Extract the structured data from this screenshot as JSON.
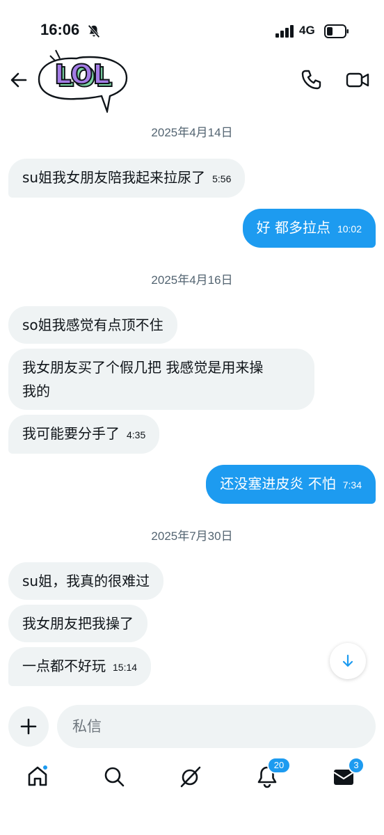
{
  "status": {
    "time": "16:06",
    "network": "4G",
    "icons": [
      "bell-muted-icon",
      "signal-icon",
      "battery-icon"
    ]
  },
  "header": {
    "avatar_text": "LOL",
    "icons": [
      "back-arrow-icon",
      "phone-icon",
      "video-icon"
    ]
  },
  "messages": {
    "date1": "2025年4月14日",
    "m1": "su姐我女朋友陪我起来拉尿了",
    "m1_time": "5:56",
    "m2": "好 都多拉点",
    "m2_time": "10:02",
    "date2": "2025年4月16日",
    "m3": "so姐我感觉有点顶不住",
    "m4_line1": "我女朋友买了个假几把 我感觉是用来操",
    "m4_line2": "我的",
    "m5": "我可能要分手了",
    "m5_time": "4:35",
    "m6": "还没塞进皮炎 不怕",
    "m6_time": "7:34",
    "date3": "2025年7月30日",
    "m7": "su姐，我真的很难过",
    "m8": "我女朋友把我操了",
    "m9": "一点都不好玩",
    "m9_time": "15:14"
  },
  "composer": {
    "placeholder": "私信"
  },
  "nav": {
    "notifications_badge": "20",
    "messages_badge": "3"
  },
  "colors": {
    "accent": "#1d9bf0",
    "incoming_bubble": "#eff3f4",
    "secondary_text": "#536471"
  }
}
